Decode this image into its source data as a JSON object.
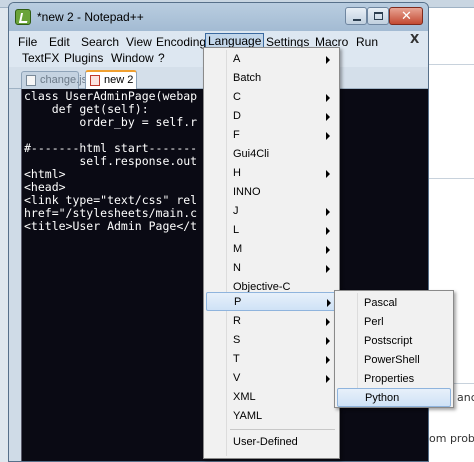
{
  "window": {
    "title": "*new  2 - Notepad++",
    "min_glyph": "",
    "close_glyph": "✕"
  },
  "menubar": {
    "row1": [
      "File",
      "Edit",
      "Search",
      "View",
      "Encoding",
      "Language",
      "Settings",
      "Macro",
      "Run"
    ],
    "row2": [
      "TextFX",
      "Plugins",
      "Window",
      "?"
    ],
    "close_doc": "X",
    "active": "Language"
  },
  "tabs": [
    {
      "label": "change.js",
      "active": false
    },
    {
      "label": "new  2",
      "active": true
    }
  ],
  "editor": {
    "lines": [
      "class UserAdminPage(webap",
      "    def get(self):",
      "        order_by = self.r",
      "",
      "#-------html start-------",
      "        self.response.out",
      "<html>",
      "<head>",
      "<link type=\"text/css\" rel",
      "href=\"/stylesheets/main.c",
      "<title>User Admin Page</t"
    ]
  },
  "language_menu": {
    "items": [
      {
        "label": "A",
        "submenu": true
      },
      {
        "label": "Batch",
        "submenu": false
      },
      {
        "label": "C",
        "submenu": true
      },
      {
        "label": "D",
        "submenu": true
      },
      {
        "label": "F",
        "submenu": true
      },
      {
        "label": "Gui4Cli",
        "submenu": false
      },
      {
        "label": "H",
        "submenu": true
      },
      {
        "label": "INNO",
        "submenu": false
      },
      {
        "label": "J",
        "submenu": true
      },
      {
        "label": "L",
        "submenu": true
      },
      {
        "label": "M",
        "submenu": true
      },
      {
        "label": "N",
        "submenu": true
      },
      {
        "label": "Objective-C",
        "submenu": false
      },
      {
        "label": "P",
        "submenu": true,
        "highlighted": true
      },
      {
        "label": "R",
        "submenu": true
      },
      {
        "label": "S",
        "submenu": true
      },
      {
        "label": "T",
        "submenu": true
      },
      {
        "label": "V",
        "submenu": true
      },
      {
        "label": "XML",
        "submenu": false
      },
      {
        "label": "YAML",
        "submenu": false
      }
    ],
    "user_defined": "User-Defined"
  },
  "p_submenu": {
    "items": [
      {
        "label": "Pascal"
      },
      {
        "label": "Perl"
      },
      {
        "label": "Postscript"
      },
      {
        "label": "PowerShell"
      },
      {
        "label": "Properties"
      },
      {
        "label": "Python",
        "highlighted": true
      }
    ]
  },
  "background": {
    "fragments": [
      "anc",
      "om probab"
    ]
  },
  "colors": {
    "editor_bg": "#0a0a14",
    "editor_fg": "#ffffff",
    "menu_highlight": "#cfe2f6",
    "titlebar": "#a3bbd3",
    "close_button": "#c34a32"
  }
}
